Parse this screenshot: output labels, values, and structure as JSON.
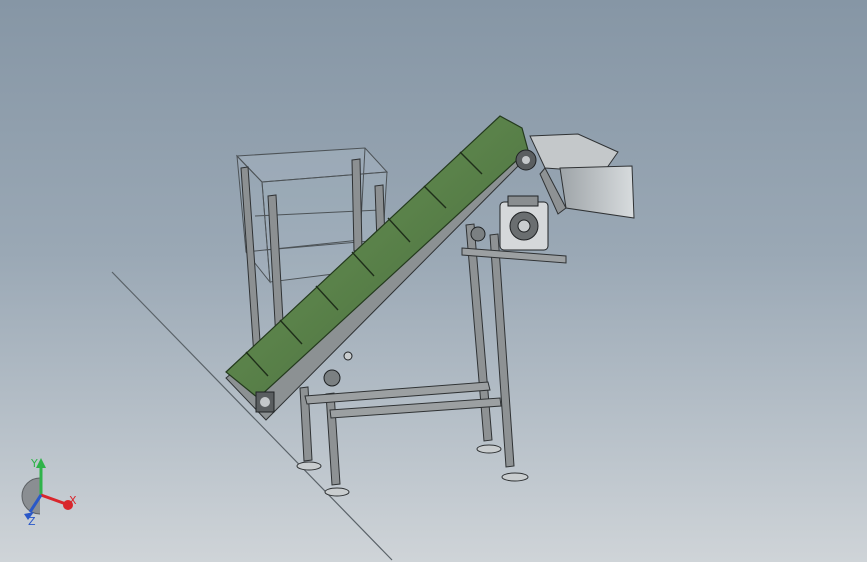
{
  "viewport": {
    "scene_description_icon": "conveyor-assembly-model",
    "background_top": "#8696a5",
    "background_bottom": "#cfd4d8"
  },
  "colors": {
    "belt_green": "#5f8a4a",
    "belt_green_dark": "#3d5f30",
    "frame_gray": "#8a8e90",
    "frame_dark": "#3a3d40",
    "steel_light": "#c7cbcd",
    "axis_x": "#d9262c",
    "axis_y": "#2fb34a",
    "axis_z": "#2a58c8"
  },
  "triad": {
    "x_label": "X",
    "y_label": "Y",
    "z_label": "Z"
  }
}
